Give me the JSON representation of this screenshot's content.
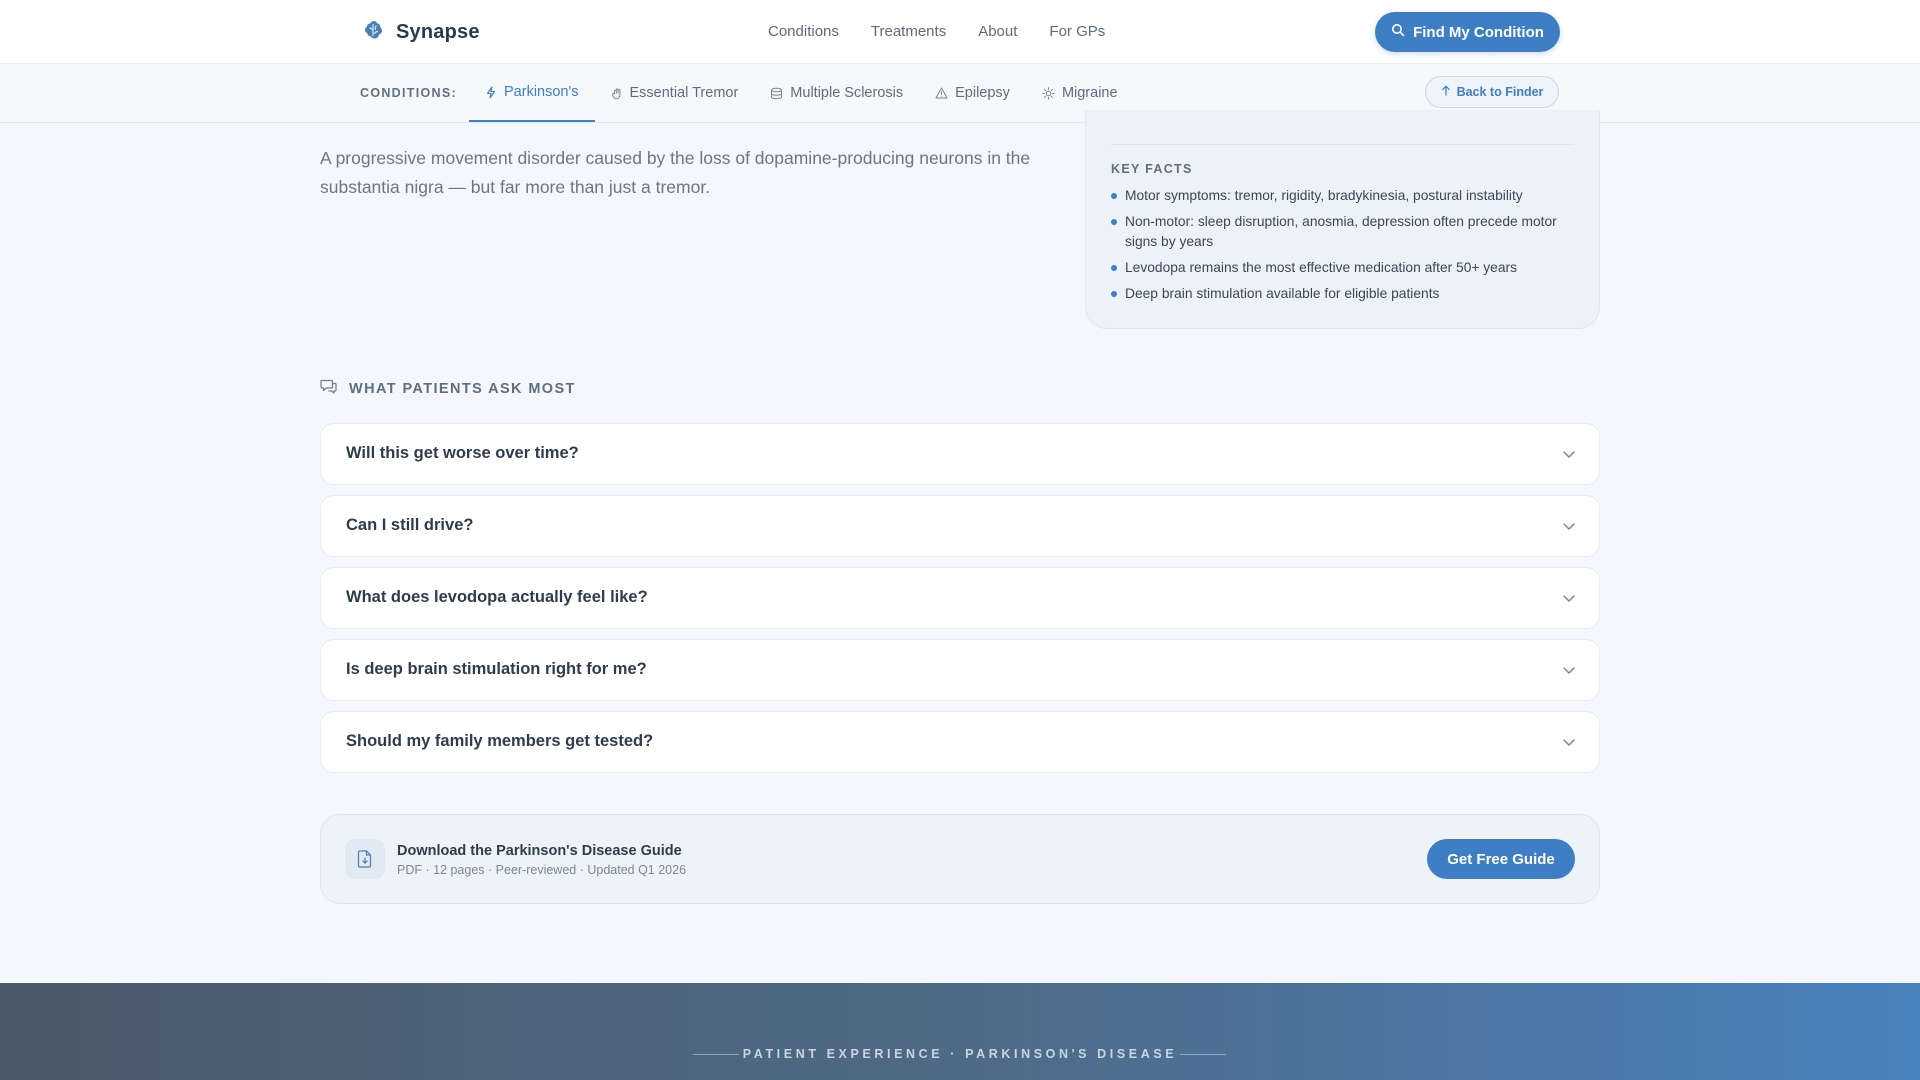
{
  "header": {
    "brand": "Synapse",
    "brand_icon": "brain-icon",
    "nav": [
      "Conditions",
      "Treatments",
      "About",
      "For GPs"
    ],
    "cta_label": "Find My Condition",
    "accent_color": "#3d7ec4"
  },
  "subnav": {
    "label": "CONDITIONS:",
    "tabs": [
      {
        "label": "Parkinson's",
        "icon": "lightning-icon",
        "active": true
      },
      {
        "label": "Essential Tremor",
        "icon": "hand-icon",
        "active": false
      },
      {
        "label": "Multiple Sclerosis",
        "icon": "layers-icon",
        "active": false
      },
      {
        "label": "Epilepsy",
        "icon": "warning-icon",
        "active": false
      },
      {
        "label": "Migraine",
        "icon": "sun-icon",
        "active": false
      }
    ],
    "back_label": "Back to Finder"
  },
  "intro": {
    "lede": "A progressive movement disorder caused by the loss of dopamine-producing neurons in the substantia nigra — but far more than just a tremor."
  },
  "key_facts": {
    "title": "KEY FACTS",
    "items": [
      "Motor symptoms: tremor, rigidity, bradykinesia, postural instability",
      "Non-motor: sleep disruption, anosmia, depression often precede motor signs by years",
      "Levodopa remains the most effective medication after 50+ years",
      "Deep brain stimulation available for eligible patients"
    ]
  },
  "faq": {
    "heading": "WHAT PATIENTS ASK MOST",
    "items": [
      "Will this get worse over time?",
      "Can I still drive?",
      "What does levodopa actually feel like?",
      "Is deep brain stimulation right for me?",
      "Should my family members get tested?"
    ]
  },
  "download": {
    "title": "Download the Parkinson's Disease Guide",
    "meta": "PDF · 12 pages · Peer-reviewed · Updated Q1 2026",
    "button": "Get Free Guide"
  },
  "footer_band": {
    "label": "PATIENT EXPERIENCE · PARKINSON'S DISEASE"
  }
}
